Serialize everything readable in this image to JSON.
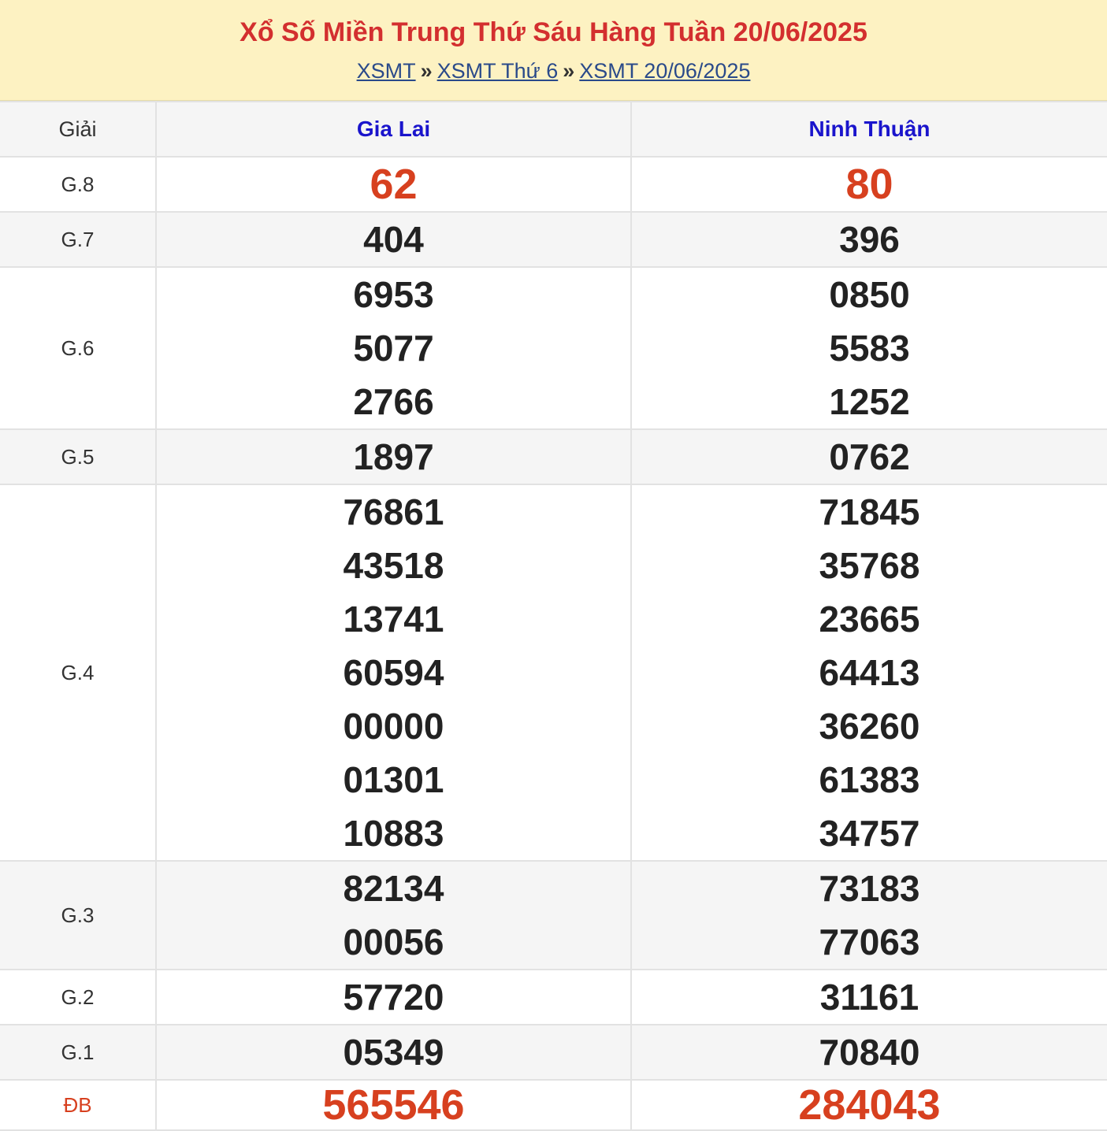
{
  "header": {
    "title": "Xổ Số Miền Trung Thứ Sáu Hàng Tuần 20/06/2025",
    "breadcrumb": [
      {
        "label": "XSMT"
      },
      {
        "label": "XSMT Thứ 6"
      },
      {
        "label": "XSMT 20/06/2025"
      }
    ],
    "separator": "»"
  },
  "table": {
    "prize_header": "Giải",
    "provinces": [
      "Gia Lai",
      "Ninh Thuận"
    ],
    "rows": [
      {
        "label": "G.8",
        "col1": [
          "62"
        ],
        "col2": [
          "80"
        ]
      },
      {
        "label": "G.7",
        "col1": [
          "404"
        ],
        "col2": [
          "396"
        ]
      },
      {
        "label": "G.6",
        "col1": [
          "6953",
          "5077",
          "2766"
        ],
        "col2": [
          "0850",
          "5583",
          "1252"
        ]
      },
      {
        "label": "G.5",
        "col1": [
          "1897"
        ],
        "col2": [
          "0762"
        ]
      },
      {
        "label": "G.4",
        "col1": [
          "76861",
          "43518",
          "13741",
          "60594",
          "00000",
          "01301",
          "10883"
        ],
        "col2": [
          "71845",
          "35768",
          "23665",
          "64413",
          "36260",
          "61383",
          "34757"
        ]
      },
      {
        "label": "G.3",
        "col1": [
          "82134",
          "00056"
        ],
        "col2": [
          "73183",
          "77063"
        ]
      },
      {
        "label": "G.2",
        "col1": [
          "57720"
        ],
        "col2": [
          "31161"
        ]
      },
      {
        "label": "G.1",
        "col1": [
          "05349"
        ],
        "col2": [
          "70840"
        ]
      },
      {
        "label": "ĐB",
        "col1": [
          "565546"
        ],
        "col2": [
          "284043"
        ]
      }
    ]
  },
  "colors": {
    "title": "#d32f2f",
    "province": "#1a14cc",
    "highlight_number": "#d7401f",
    "header_bg": "#fdf2c2"
  }
}
